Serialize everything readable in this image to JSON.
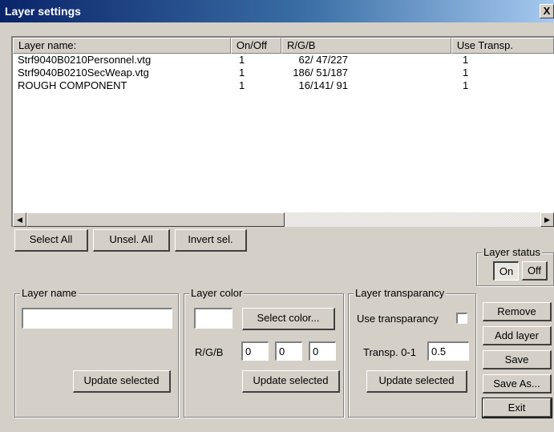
{
  "window": {
    "title": "Layer settings",
    "close_glyph": "X"
  },
  "table": {
    "columns": [
      "Layer name:",
      "On/Off",
      "R/G/B",
      "Use Transp."
    ],
    "rows": [
      {
        "name": "Strf9040B0210Personnel.vtg",
        "onoff": "1",
        "rgb": "62/ 47/227",
        "transp": "1"
      },
      {
        "name": "Strf9040B0210SecWeap.vtg",
        "onoff": "1",
        "rgb": "186/ 51/187",
        "transp": "1"
      },
      {
        "name": "ROUGH COMPONENT",
        "onoff": "1",
        "rgb": "16/141/ 91",
        "transp": "1"
      }
    ]
  },
  "scrollbar": {
    "left_icon": "scroll-left-arrow",
    "right_icon": "scroll-right-arrow"
  },
  "selection_buttons": {
    "select_all": "Select All",
    "unselect_all": "Unsel. All",
    "invert": "Invert sel."
  },
  "layer_status": {
    "title": "Layer status",
    "on": "On",
    "off": "Off",
    "active": "On"
  },
  "layer_name_group": {
    "title": "Layer name",
    "value": "",
    "update": "Update selected"
  },
  "layer_color_group": {
    "title": "Layer color",
    "select_color": "Select color...",
    "rgb_label": "R/G/B",
    "r": "0",
    "g": "0",
    "b": "0",
    "update": "Update selected"
  },
  "layer_transparency_group": {
    "title": "Layer transparancy",
    "use_label": "Use transparancy",
    "use_checked": false,
    "transp_label": "Transp. 0-1",
    "transp_value": "0.5",
    "update": "Update selected"
  },
  "side_buttons": {
    "remove": "Remove",
    "add_layer": "Add layer",
    "save": "Save",
    "save_as": "Save As...",
    "exit": "Exit"
  }
}
